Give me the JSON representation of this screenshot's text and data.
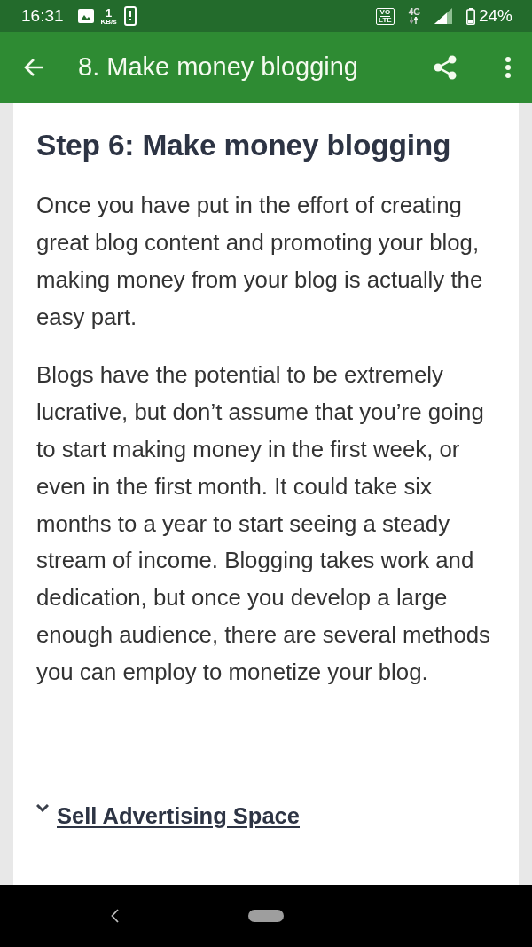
{
  "status_bar": {
    "time": "16:31",
    "net_speed_value": "1",
    "net_speed_unit": "KB/s",
    "volte_top": "VO",
    "volte_bottom": "LTE",
    "network": "4G",
    "battery": "24%"
  },
  "app_bar": {
    "title": "8. Make money blogging"
  },
  "article": {
    "heading": "Step 6: Make money blogging",
    "paragraphs": [
      "Once you have put in the effort of creating great blog content and promoting your blog, making money from your blog is actually the easy part.",
      "Blogs have the potential to be extremely lucrative, but don’t assume that you’re going to start making money in the first week, or even in the first month. It could take six months to a year to start seeing a steady stream of income. Blogging takes work and dedication, but once you develop a large enough audience, there are several methods you can employ to monetize your blog."
    ],
    "section_link": "Sell Advertising Space"
  }
}
